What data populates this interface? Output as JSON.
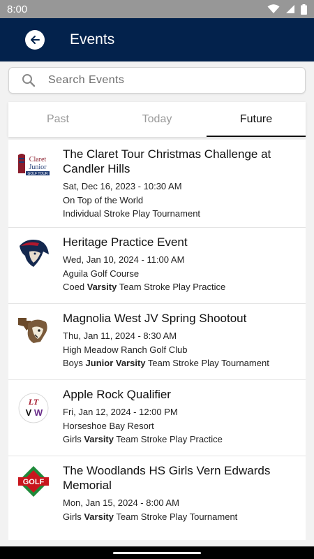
{
  "status_bar": {
    "time": "8:00"
  },
  "header": {
    "title": "Events"
  },
  "search": {
    "placeholder": "Search Events",
    "value": ""
  },
  "tabs": [
    {
      "label": "Past",
      "active": false
    },
    {
      "label": "Today",
      "active": false
    },
    {
      "label": "Future",
      "active": true
    }
  ],
  "events": [
    {
      "title": "The Claret Tour Christmas Challenge at Candler Hills",
      "datetime": "Sat, Dec 16, 2023 - 10:30 AM",
      "location": "On Top of the World",
      "type_prefix": "",
      "type_bold": "",
      "type_suffix": "Individual Stroke Play Tournament",
      "logo": "claret-junior-golf-tour-logo",
      "logo_text": {
        "line1": "Claret",
        "line2": "Junior",
        "line3": "GOLF TOUR"
      }
    },
    {
      "title": "Heritage Practice Event",
      "datetime": "Wed, Jan 10, 2024 - 11:00 AM",
      "location": "Aguila Golf Course",
      "type_prefix": "Coed",
      "type_bold": "Varsity",
      "type_suffix": "Team Stroke Play Practice",
      "logo": "patriot-mascot-logo"
    },
    {
      "title": "Magnolia West JV Spring Shootout",
      "datetime": "Thu, Jan 11, 2024 - 8:30 AM",
      "location": "High Meadow Ranch Golf Club",
      "type_prefix": "Boys",
      "type_bold": "Junior Varsity",
      "type_suffix": "Team Stroke Play Tournament",
      "logo": "mustang-texas-logo"
    },
    {
      "title": "Apple Rock Qualifier",
      "datetime": "Fri, Jan 12, 2024 - 12:00 PM",
      "location": "Horseshoe Bay Resort",
      "type_prefix": "Girls",
      "type_bold": "Varsity",
      "type_suffix": "Team Stroke Play Practice",
      "logo": "ltvw-logo",
      "logo_text": {
        "top": "LT",
        "left": "V",
        "right": "W"
      }
    },
    {
      "title": "The Woodlands HS Girls Vern Edwards Memorial",
      "datetime": "Mon, Jan 15, 2024 - 8:00 AM",
      "location": "",
      "type_prefix": "Girls",
      "type_bold": "Varsity",
      "type_suffix": "Team Stroke Play Tournament",
      "logo": "golf-red-green-logo",
      "logo_text": {
        "word": "GOLF"
      }
    }
  ],
  "colors": {
    "app_bar": "#03224c",
    "status_bar": "#979797",
    "accent": "#111111"
  }
}
